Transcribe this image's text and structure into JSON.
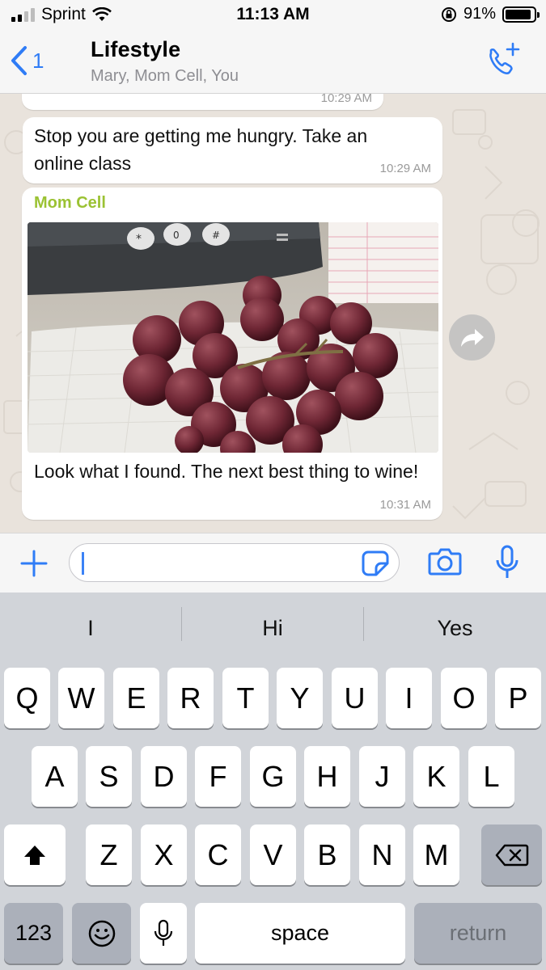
{
  "status_bar": {
    "carrier": "Sprint",
    "time": "11:13 AM",
    "battery": "91%",
    "battery_level": 0.91
  },
  "header": {
    "back_count": "1",
    "title": "Lifestyle",
    "subtitle": "Mary, Mom Cell, You"
  },
  "messages": [
    {
      "time": "10:29 AM"
    },
    {
      "text": "Stop you are getting me hungry. Take an online class",
      "time": "10:29 AM"
    },
    {
      "sender": "Mom Cell",
      "text": "Look what I found.  The next best thing to wine!",
      "time": "10:31 AM"
    }
  ],
  "colors": {
    "accent": "#2f7cf6",
    "sender_name": "#9bc233",
    "chat_background": "#e9e3dc"
  },
  "icons": {
    "forward": "forward-arrow-icon",
    "call_add": "phone-plus-icon",
    "attach": "plus-icon",
    "sticker": "sticker-icon",
    "camera": "camera-icon",
    "mic": "microphone-icon"
  },
  "keyboard": {
    "suggestions": [
      "I",
      "Hi",
      "Yes"
    ],
    "row1": [
      "Q",
      "W",
      "E",
      "R",
      "T",
      "Y",
      "U",
      "I",
      "O",
      "P"
    ],
    "row2": [
      "A",
      "S",
      "D",
      "F",
      "G",
      "H",
      "J",
      "K",
      "L"
    ],
    "row3": [
      "Z",
      "X",
      "C",
      "V",
      "B",
      "N",
      "M"
    ],
    "numbers_label": "123",
    "space_label": "space",
    "return_label": "return"
  }
}
